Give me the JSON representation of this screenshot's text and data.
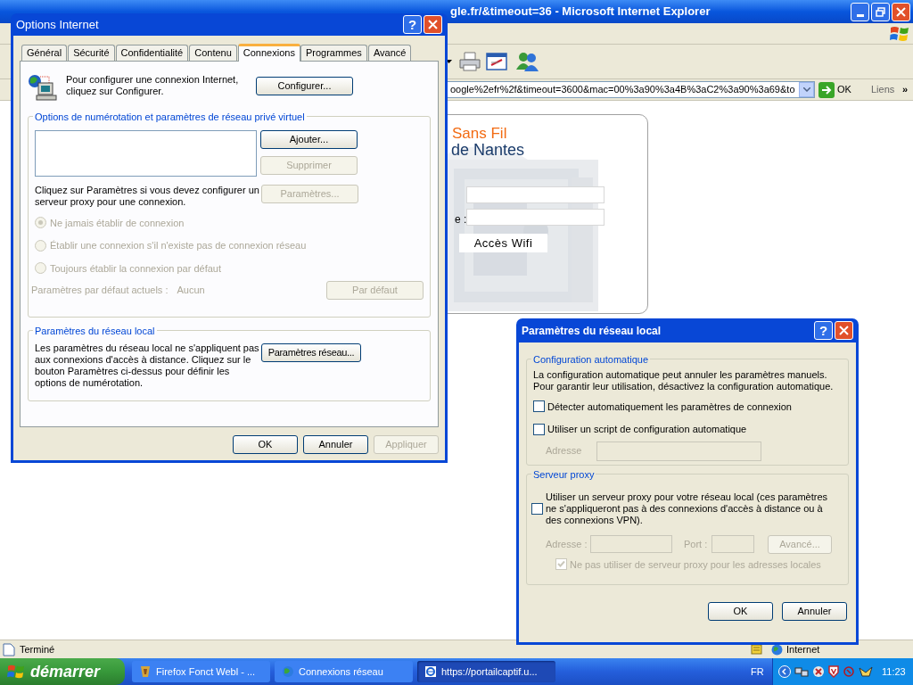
{
  "browser": {
    "title": "gle.fr/&timeout=36 - Microsoft Internet Explorer",
    "address": "oogle%2efr%2f&timeout=3600&mac=00%3a90%3a4B%3aC2%3a90%3a69&to",
    "go": "OK",
    "links": "Liens",
    "links_more": "»"
  },
  "page": {
    "title_1": "Sans Fil",
    "title_2": "de Nantes",
    "field_label": "e :",
    "button": "Accès Wifi"
  },
  "status_bar": {
    "text": "Terminé",
    "zone": "Internet"
  },
  "options_dialog": {
    "title": "Options Internet",
    "help": "?",
    "tabs": [
      {
        "label": "Général",
        "selected": false
      },
      {
        "label": "Sécurité",
        "selected": false
      },
      {
        "label": "Confidentialité",
        "selected": false
      },
      {
        "label": "Contenu",
        "selected": false
      },
      {
        "label": "Connexions",
        "selected": true
      },
      {
        "label": "Programmes",
        "selected": false
      },
      {
        "label": "Avancé",
        "selected": false
      }
    ],
    "setup_text": "Pour configurer une connexion Internet, cliquez sur Configurer.",
    "setup_button": {
      "label": "Configurer...",
      "disabled": false
    },
    "dialup": {
      "legend": "Options de numérotation et paramètres de réseau privé virtuel",
      "add_button": {
        "label": "Ajouter...",
        "disabled": false
      },
      "remove_button": {
        "label": "Supprimer",
        "disabled": true
      },
      "proxy_text": "Cliquez sur Paramètres si vous devez configurer un serveur proxy pour une connexion.",
      "settings_button": {
        "label": "Paramètres...",
        "disabled": true
      },
      "radios": [
        {
          "label": "Ne jamais établir de connexion",
          "selected": true,
          "disabled": true
        },
        {
          "label": "Établir une connexion s'il n'existe pas de connexion réseau",
          "selected": false,
          "disabled": true
        },
        {
          "label": "Toujours établir la connexion par défaut",
          "selected": false,
          "disabled": true
        }
      ],
      "default_label": "Paramètres par défaut actuels :",
      "default_value": "Aucun",
      "default_button": {
        "label": "Par défaut",
        "disabled": true
      }
    },
    "lan": {
      "legend": "Paramètres du réseau local",
      "text": "Les paramètres du réseau local ne s'appliquent pas aux connexions d'accès à distance. Cliquez sur le bouton Paramètres ci-dessus pour définir les options de numérotation.",
      "button": {
        "label": "Paramètres réseau...",
        "disabled": false
      }
    },
    "buttons": [
      {
        "label": "OK",
        "disabled": false
      },
      {
        "label": "Annuler",
        "disabled": false
      },
      {
        "label": "Appliquer",
        "disabled": true
      }
    ]
  },
  "lan_dialog": {
    "title": "Paramètres du réseau local",
    "help": "?",
    "auto": {
      "legend": "Configuration automatique",
      "text": "La configuration automatique peut annuler les paramètres manuels. Pour garantir leur utilisation, désactivez la configuration automatique.",
      "checks": [
        {
          "label": "Détecter automatiquement les paramètres de connexion",
          "checked": false
        },
        {
          "label": "Utiliser un script de configuration automatique",
          "checked": false
        }
      ],
      "address_label": "Adresse",
      "address_disabled": true
    },
    "proxy": {
      "legend": "Serveur proxy",
      "check": {
        "label": "Utiliser un serveur proxy pour votre réseau local (ces paramètres ne s'appliqueront pas à des connexions d'accès à distance ou à des connexions VPN).",
        "checked": false
      },
      "address_label": "Adresse :",
      "port_label": "Port :",
      "advanced_button": {
        "label": "Avancé...",
        "disabled": true
      },
      "bypass": {
        "label": "Ne pas utiliser de serveur proxy pour les adresses locales",
        "checked": true,
        "disabled": true
      }
    },
    "buttons": [
      {
        "label": "OK",
        "disabled": false
      },
      {
        "label": "Annuler",
        "disabled": false
      }
    ]
  },
  "taskbar": {
    "start": "démarrer",
    "tasks": [
      {
        "label": "Firefox Fonct Webl - ...",
        "selected": false,
        "kind": "firefox"
      },
      {
        "label": "Connexions réseau",
        "selected": false,
        "kind": "network"
      },
      {
        "label": "https://portailcaptif.u...",
        "selected": true,
        "kind": "ie"
      }
    ],
    "language": "FR",
    "clock": "11:23"
  }
}
